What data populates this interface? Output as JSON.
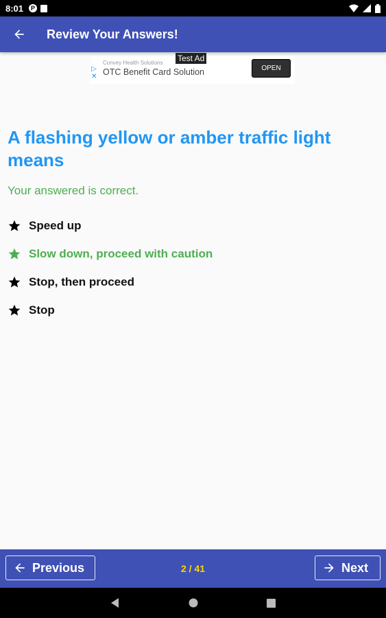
{
  "status_bar": {
    "time": "8:01",
    "notif_icon_letter": "P"
  },
  "app_bar": {
    "title": "Review Your Answers!"
  },
  "ad": {
    "test_label": "Test Ad",
    "sponsor": "Convey Health Solutions",
    "headline": "OTC Benefit Card Solution",
    "cta": "OPEN"
  },
  "question": {
    "text": "A flashing yellow or amber traffic light means",
    "feedback": "Your answered is correct.",
    "options": [
      {
        "label": "Speed up",
        "correct": false
      },
      {
        "label": "Slow down, proceed with caution",
        "correct": true
      },
      {
        "label": "Stop, then proceed",
        "correct": false
      },
      {
        "label": "Stop",
        "correct": false
      }
    ]
  },
  "navigation": {
    "previous_label": "Previous",
    "next_label": "Next",
    "page_indicator": "2 / 41"
  },
  "colors": {
    "primary": "#3f51b5",
    "question": "#2196f3",
    "correct": "#4caf50",
    "page_indicator": "#ffd600"
  }
}
